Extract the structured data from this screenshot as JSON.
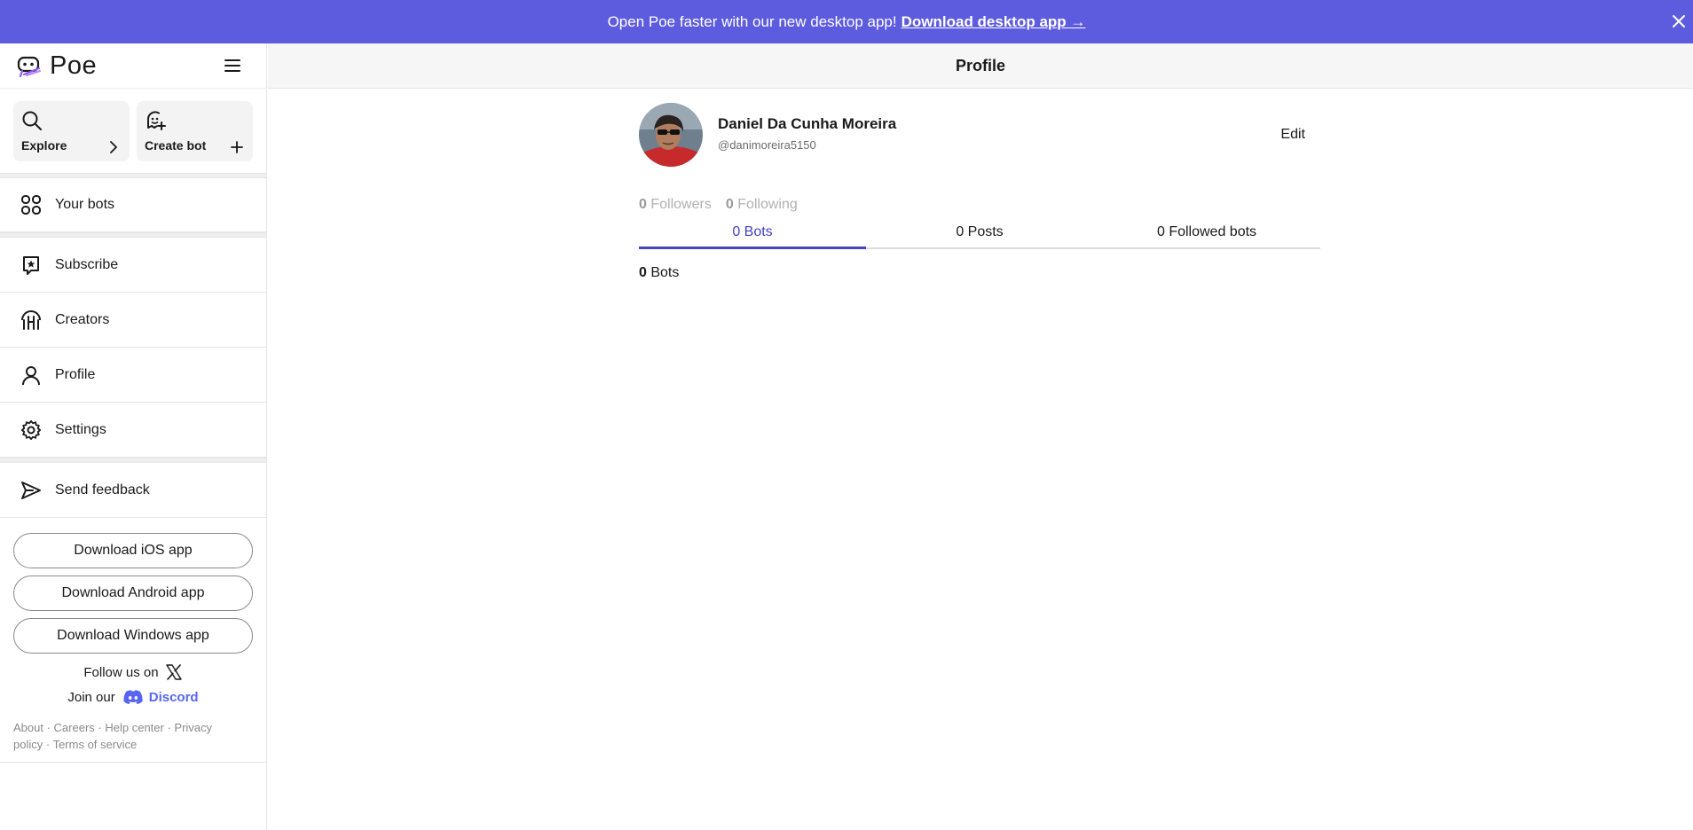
{
  "banner": {
    "message": "Open Poe faster with our new desktop app!",
    "link": "Download desktop app →",
    "bg_color": "#5d5cde"
  },
  "sidebar": {
    "logo": "Poe",
    "tiles": [
      {
        "label": "Explore",
        "icon": "search-icon",
        "trail_icon": "chevron-right-icon"
      },
      {
        "label": "Create bot",
        "icon": "bot-plus-icon",
        "trail_icon": "plus-icon"
      }
    ],
    "nav": [
      {
        "label": "Your bots",
        "icon": "bots-grid-icon"
      },
      {
        "label": "Subscribe",
        "icon": "star-badge-icon"
      },
      {
        "label": "Creators",
        "icon": "creators-icon"
      },
      {
        "label": "Profile",
        "icon": "user-icon"
      },
      {
        "label": "Settings",
        "icon": "gear-icon"
      },
      {
        "label": "Send feedback",
        "icon": "send-icon"
      }
    ],
    "downloads": [
      {
        "label": "Download iOS app"
      },
      {
        "label": "Download Android app"
      },
      {
        "label": "Download Windows app"
      }
    ],
    "follow_text": "Follow us on",
    "join_text": "Join our",
    "discord_label": "Discord",
    "footer_links": [
      "About",
      "Careers",
      "Help center",
      "Privacy policy",
      "Terms of service"
    ]
  },
  "main": {
    "header_title": "Profile",
    "profile": {
      "name": "Daniel Da Cunha Moreira",
      "handle": "@danimoreira5150",
      "edit_label": "Edit",
      "followers_count": "0",
      "followers_label": "Followers",
      "following_count": "0",
      "following_label": "Following"
    },
    "tabs": [
      {
        "label": "0 Bots",
        "active": true
      },
      {
        "label": "0 Posts",
        "active": false
      },
      {
        "label": "0 Followed bots",
        "active": false
      }
    ],
    "bots_count": "0",
    "bots_label": "Bots",
    "accent_color": "#4343c3"
  }
}
